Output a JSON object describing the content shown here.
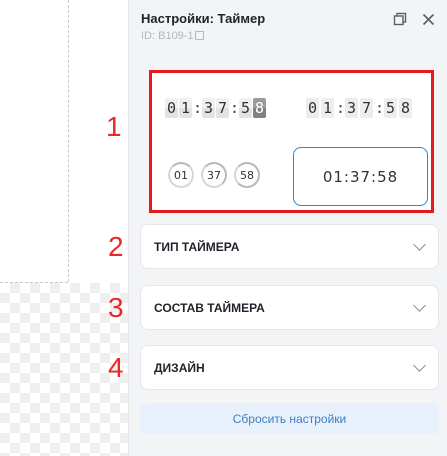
{
  "header": {
    "title": "Настройки: Таймер",
    "id_text": "ID: B109-1",
    "restore_icon": "restore-window-icon",
    "close_icon": "close-icon"
  },
  "annotations": [
    "1",
    "2",
    "3",
    "4"
  ],
  "preview": {
    "flip_timer": [
      "0",
      "1",
      ":",
      "3",
      "7",
      ":",
      "5",
      "8"
    ],
    "card_timer": [
      "0",
      "1",
      ":",
      "3",
      "7",
      ":",
      "5",
      "8"
    ],
    "circle_timer": [
      "01",
      "37",
      "58"
    ],
    "plain_timer": "01:37:58",
    "highlight_color": "#e51b1b",
    "selected_border_color": "#2f86d6"
  },
  "sections": [
    {
      "label": "ТИП ТАЙМЕРА"
    },
    {
      "label": "СОСТАВ ТАЙМЕРА"
    },
    {
      "label": "ДИЗАЙН"
    }
  ],
  "reset_label": "Сбросить настройки",
  "colors": {
    "accent_blue": "#3e7fc2",
    "reset_bg": "#e8f1fb"
  }
}
